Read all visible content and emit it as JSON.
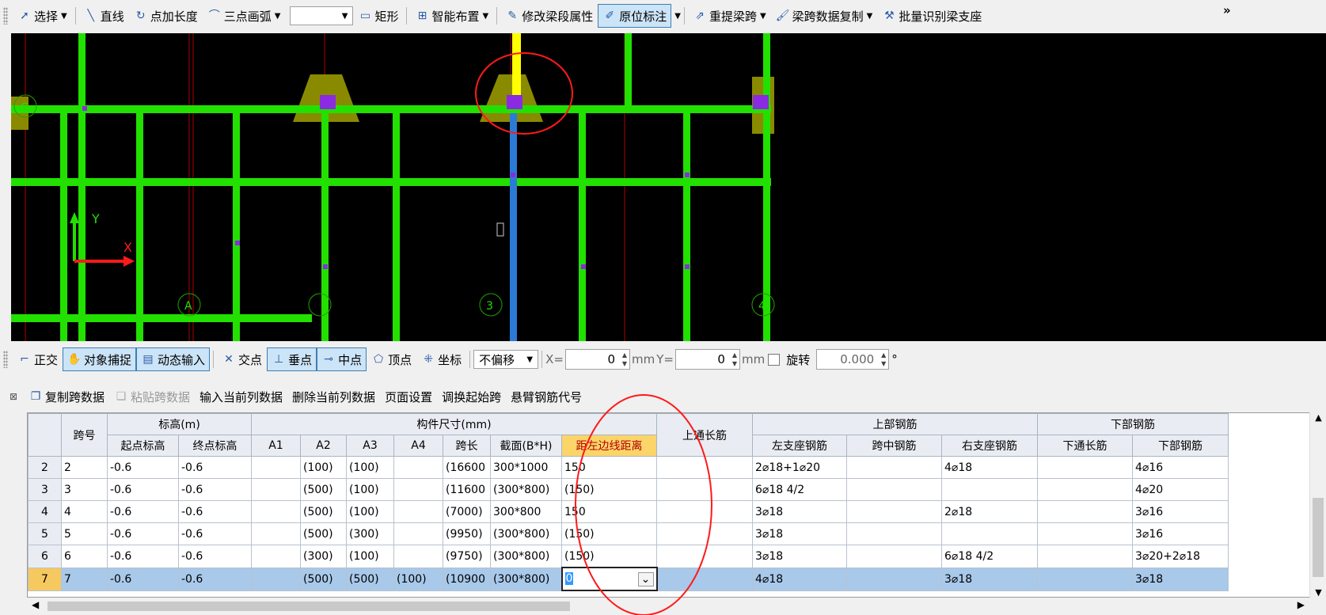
{
  "toolbar": {
    "select": "选择",
    "line": "直线",
    "point_length": "点加长度",
    "arc3": "三点画弧",
    "rect": "矩形",
    "smart": "智能布置",
    "modify_attr": "修改梁段属性",
    "inplace": "原位标注",
    "reextract": "重提梁跨",
    "copy_span": "梁跨数据复制",
    "batch": "批量识别梁支座",
    "more": "»"
  },
  "canvas": {
    "axis_y": "Y",
    "axis_x": "X",
    "col_labels": [
      "C",
      "A",
      "3",
      "4"
    ]
  },
  "snapbar": {
    "ortho": "正交",
    "snap": "对象捕捉",
    "dynamic": "动态输入",
    "intersect": "交点",
    "perp": "垂点",
    "mid": "中点",
    "vertex": "顶点",
    "coord": "坐标",
    "offset": "不偏移",
    "x_label": "X=",
    "x_value": "0",
    "y_label": "Y=",
    "y_value": "0",
    "unit": "mm",
    "rotate_label": "旋转",
    "rotate_value": "0.000",
    "degree": "°"
  },
  "tablebar": {
    "copy": "复制跨数据",
    "paste": "粘贴跨数据",
    "input_col": "输入当前列数据",
    "delete_col": "删除当前列数据",
    "page": "页面设置",
    "swap": "调换起始跨",
    "cantilever": "悬臂钢筋代号"
  },
  "table": {
    "headers": {
      "span": "跨号",
      "elev": "标高(m)",
      "start_elev": "起点标高",
      "end_elev": "终点标高",
      "size": "构件尺寸(mm)",
      "a1": "A1",
      "a2": "A2",
      "a3": "A3",
      "a4": "A4",
      "length": "跨长",
      "section": "截面(B*H)",
      "dist": "距左边线距离",
      "top_through": "上通长筋",
      "top": "上部钢筋",
      "left_seat": "左支座钢筋",
      "mid": "跨中钢筋",
      "right_seat": "右支座钢筋",
      "bottom": "下部钢筋",
      "bot_through": "下通长筋",
      "bot_bar": "下部钢筋"
    },
    "rows": [
      {
        "n": "2",
        "span": "2",
        "se": "-0.6",
        "ee": "-0.6",
        "a1": "",
        "a2": "(100)",
        "a3": "(100)",
        "a4": "",
        "len": "(16600",
        "sec": "300*1000",
        "dist": "150",
        "tt": "",
        "ls": "2⌀18+1⌀20",
        "ms": "",
        "rs": "4⌀18",
        "bt": "",
        "bb": "4⌀16"
      },
      {
        "n": "3",
        "span": "3",
        "se": "-0.6",
        "ee": "-0.6",
        "a1": "",
        "a2": "(500)",
        "a3": "(100)",
        "a4": "",
        "len": "(11600",
        "sec": "(300*800)",
        "dist": "(150)",
        "tt": "",
        "ls": "6⌀18 4/2",
        "ms": "",
        "rs": "",
        "bt": "",
        "bb": "4⌀20"
      },
      {
        "n": "4",
        "span": "4",
        "se": "-0.6",
        "ee": "-0.6",
        "a1": "",
        "a2": "(500)",
        "a3": "(100)",
        "a4": "",
        "len": "(7000)",
        "sec": "300*800",
        "dist": "150",
        "tt": "",
        "ls": "3⌀18",
        "ms": "",
        "rs": "2⌀18",
        "bt": "",
        "bb": "3⌀16"
      },
      {
        "n": "5",
        "span": "5",
        "se": "-0.6",
        "ee": "-0.6",
        "a1": "",
        "a2": "(500)",
        "a3": "(300)",
        "a4": "",
        "len": "(9950)",
        "sec": "(300*800)",
        "dist": "(150)",
        "tt": "",
        "ls": "3⌀18",
        "ms": "",
        "rs": "",
        "bt": "",
        "bb": "3⌀16"
      },
      {
        "n": "6",
        "span": "6",
        "se": "-0.6",
        "ee": "-0.6",
        "a1": "",
        "a2": "(300)",
        "a3": "(100)",
        "a4": "",
        "len": "(9750)",
        "sec": "(300*800)",
        "dist": "(150)",
        "tt": "",
        "ls": "3⌀18",
        "ms": "",
        "rs": "6⌀18 4/2",
        "bt": "",
        "bb": "3⌀20+2⌀18"
      },
      {
        "n": "7",
        "span": "7",
        "se": "-0.6",
        "ee": "-0.6",
        "a1": "",
        "a2": "(500)",
        "a3": "(500)",
        "a4": "(100)",
        "len": "(10900",
        "sec": "(300*800)",
        "dist": "0",
        "tt": "",
        "ls": "4⌀18",
        "ms": "",
        "rs": "3⌀18",
        "bt": "",
        "bb": "3⌀18"
      }
    ],
    "selected_row": "7"
  }
}
